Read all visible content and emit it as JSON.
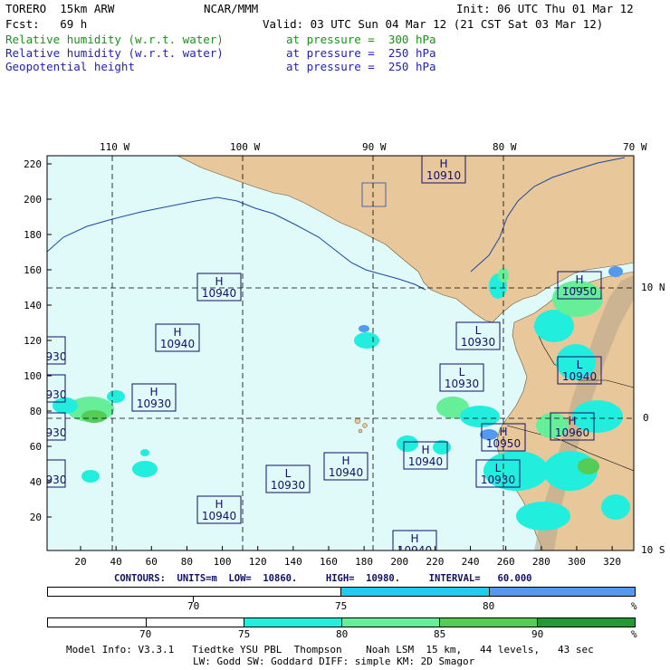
{
  "header": {
    "model": "TORERO  15km ARW",
    "org": "NCAR/MMM",
    "init": "Init: 06 UTC Thu 01 Mar 12",
    "fcst": "Fcst:   69 h",
    "valid": "Valid: 03 UTC Sun 04 Mar 12 (21 CST Sat 03 Mar 12)",
    "fields": [
      {
        "name": "Relative humidity (w.r.t. water)",
        "level": "at pressure =  300 hPa",
        "color": "#1f8f1f"
      },
      {
        "name": "Relative humidity (w.r.t. water)",
        "level": "at pressure =  250 hPa",
        "color": "#1f1fbf"
      },
      {
        "name": "Geopotential height",
        "level": "at pressure =  250 hPa",
        "color": "#1f1fbf"
      }
    ]
  },
  "map": {
    "lon_labels": [
      "110 W",
      "100 W",
      "90 W",
      "80 W",
      "70 W"
    ],
    "lat_labels": [
      "10 N",
      "0",
      "10 S"
    ],
    "y_ticks": [
      "220",
      "200",
      "180",
      "160",
      "140",
      "120",
      "100",
      "80",
      "60",
      "40",
      "20"
    ],
    "x_ticks": [
      "20",
      "40",
      "60",
      "80",
      "100",
      "120",
      "140",
      "160",
      "180",
      "200",
      "220",
      "240",
      "260",
      "280",
      "300",
      "320"
    ],
    "ocean_color": "#e0fafa",
    "land_color": "#e8c89a",
    "pressure_centers": [
      {
        "type": "H",
        "value": "10910"
      },
      {
        "type": "H",
        "value": "10940"
      },
      {
        "type": "H",
        "value": "10940"
      },
      {
        "type": "H",
        "value": "10930"
      },
      {
        "type": "L",
        "value": "10930"
      },
      {
        "type": "L",
        "value": "10930"
      },
      {
        "type": "H",
        "value": "10950"
      },
      {
        "type": "L",
        "value": "10940"
      },
      {
        "type": "H",
        "value": "10960"
      },
      {
        "type": "H",
        "value": "10950"
      },
      {
        "type": "H",
        "value": "10940"
      },
      {
        "type": "L",
        "value": "10930"
      },
      {
        "type": "H",
        "value": "10940"
      },
      {
        "type": "L",
        "value": "10930"
      },
      {
        "type": "H",
        "value": "10940"
      },
      {
        "type": "H",
        "value": "10940"
      },
      {
        "type": "",
        "value": "930"
      },
      {
        "type": "",
        "value": "930"
      },
      {
        "type": "",
        "value": "930"
      },
      {
        "type": "",
        "value": "930"
      },
      {
        "type": "H",
        "value": ""
      }
    ]
  },
  "contours": {
    "label": "CONTOURS:  UNITS=m  LOW=  10860.     HIGH=  10980.     INTERVAL=   60.000"
  },
  "colorbar1": {
    "labels": [
      "70",
      "75",
      "80",
      "%"
    ],
    "colors": [
      "#ffffff",
      "#22ccee",
      "#5599ee"
    ]
  },
  "colorbar2": {
    "labels": [
      "70",
      "75",
      "80",
      "85",
      "90",
      "%"
    ],
    "colors": [
      "#ffffff",
      "#ffffff",
      "#22eedd",
      "#66ee99",
      "#55cc55",
      "#229933"
    ]
  },
  "footer": {
    "line1": "Model Info: V3.3.1   Tiedtke YSU PBL  Thompson    Noah LSM  15 km,   44 levels,   43 sec",
    "line2": "LW: Godd SW: Goddard DIFF: simple KM: 2D Smagor"
  }
}
